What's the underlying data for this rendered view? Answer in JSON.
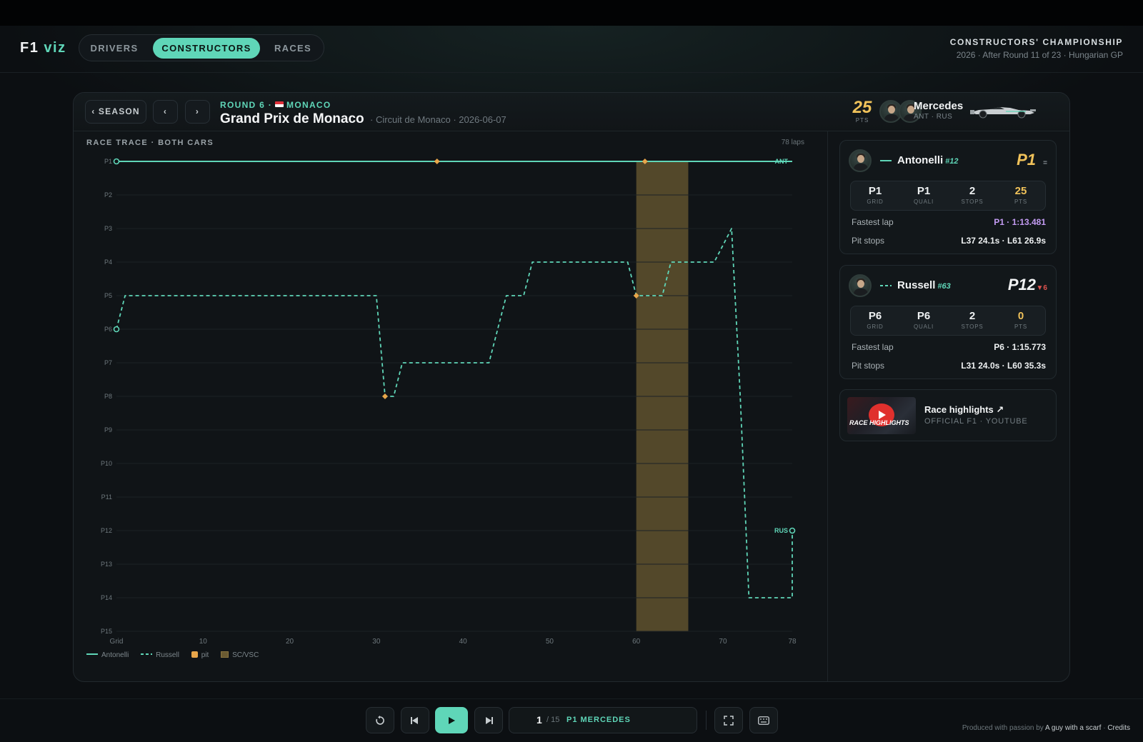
{
  "app": {
    "logo_main": "F1",
    "logo_accent": "viz"
  },
  "nav": {
    "tabs": [
      "DRIVERS",
      "CONSTRUCTORS",
      "RACES"
    ],
    "active": "CONSTRUCTORS"
  },
  "championship": {
    "title": "CONSTRUCTORS' CHAMPIONSHIP",
    "subtitle": "2026 · After Round 11 of 23 · Hungarian GP"
  },
  "race": {
    "season_button": "‹ SEASON",
    "prev": "‹",
    "next": "›",
    "round_label": "ROUND 6 ·",
    "country": "MONACO",
    "title": "Grand Prix de Monaco",
    "subtitle": "· Circuit de Monaco · 2026-06-07"
  },
  "team": {
    "points": "25",
    "points_label": "PTS",
    "name": "Mercedes",
    "drivers": "ANT · RUS"
  },
  "chart_title": "RACE TRACE · BOTH CARS",
  "laps_note": "78 laps",
  "legend": {
    "antonelli": "Antonelli",
    "russell": "Russell",
    "pit": "pit",
    "sc": "SC/VSC"
  },
  "chart_data": {
    "type": "line",
    "title": "RACE TRACE · BOTH CARS",
    "x_ticks": [
      "Grid",
      "10",
      "20",
      "30",
      "40",
      "50",
      "60",
      "70",
      "78"
    ],
    "xlim": [
      0,
      78
    ],
    "y_ticks": [
      "P1",
      "P2",
      "P3",
      "P4",
      "P5",
      "P6",
      "P7",
      "P8",
      "P9",
      "P10",
      "P11",
      "P12",
      "P13",
      "P14",
      "P15"
    ],
    "ylim": [
      1,
      15
    ],
    "y_inverted": true,
    "grid": true,
    "sc_periods": [
      [
        60,
        66
      ]
    ],
    "series": [
      {
        "name": "Antonelli",
        "end_label": "ANT",
        "style": "solid",
        "color": "#5fd6b8",
        "points": [
          [
            0,
            1
          ],
          [
            78,
            1
          ]
        ],
        "pits": [
          [
            37,
            1
          ],
          [
            61,
            1
          ]
        ]
      },
      {
        "name": "Russell",
        "end_label": "RUS",
        "style": "dashed",
        "color": "#5fd6b8",
        "points": [
          [
            0,
            6
          ],
          [
            1,
            5
          ],
          [
            30,
            5
          ],
          [
            31,
            8
          ],
          [
            32,
            8
          ],
          [
            33,
            7
          ],
          [
            43,
            7
          ],
          [
            45,
            5
          ],
          [
            47,
            5
          ],
          [
            48,
            4
          ],
          [
            59,
            4
          ],
          [
            60,
            5
          ],
          [
            63,
            5
          ],
          [
            64,
            4
          ],
          [
            69,
            4
          ],
          [
            71,
            3
          ],
          [
            72,
            8
          ],
          [
            73,
            14
          ],
          [
            78,
            14
          ],
          [
            78,
            12
          ]
        ],
        "pits": [
          [
            31,
            8
          ],
          [
            60,
            5
          ]
        ]
      }
    ]
  },
  "drivers": [
    {
      "name": "Antonelli",
      "number": "#12",
      "position": "P1",
      "delta": "=",
      "stats": [
        {
          "value": "P1",
          "label": "GRID"
        },
        {
          "value": "P1",
          "label": "QUALI"
        },
        {
          "value": "2",
          "label": "STOPS"
        },
        {
          "value": "25",
          "label": "PTS"
        }
      ],
      "fastest_label": "Fastest lap",
      "fastest_value": "P1 · 1:13.481",
      "pit_label": "Pit stops",
      "pit_value": "L37 24.1s · L61 26.9s"
    },
    {
      "name": "Russell",
      "number": "#63",
      "position": "P12",
      "delta": "▼6",
      "stats": [
        {
          "value": "P6",
          "label": "GRID"
        },
        {
          "value": "P6",
          "label": "QUALI"
        },
        {
          "value": "2",
          "label": "STOPS"
        },
        {
          "value": "0",
          "label": "PTS"
        }
      ],
      "fastest_label": "Fastest lap",
      "fastest_value": "P6 · 1:15.773",
      "pit_label": "Pit stops",
      "pit_value": "L31 24.0s · L60 35.3s"
    }
  ],
  "highlights": {
    "title": "Race highlights ↗",
    "subtitle": "OFFICIAL F1 · YOUTUBE",
    "thumb_text": "RACE HIGHLIGHTS"
  },
  "player": {
    "current": "1",
    "total": "/ 15",
    "label": "P1 MERCEDES"
  },
  "credits": {
    "prefix": "Produced with passion by",
    "author": "A guy with a scarf",
    "sep": "·",
    "link": "Credits"
  },
  "colors": {
    "accent": "#5fd6b8",
    "gold": "#f0c25a",
    "pit": "#e8a64a",
    "sc": "#6a5a32",
    "fastest": "#c39bf3",
    "loss": "#e0534f"
  }
}
